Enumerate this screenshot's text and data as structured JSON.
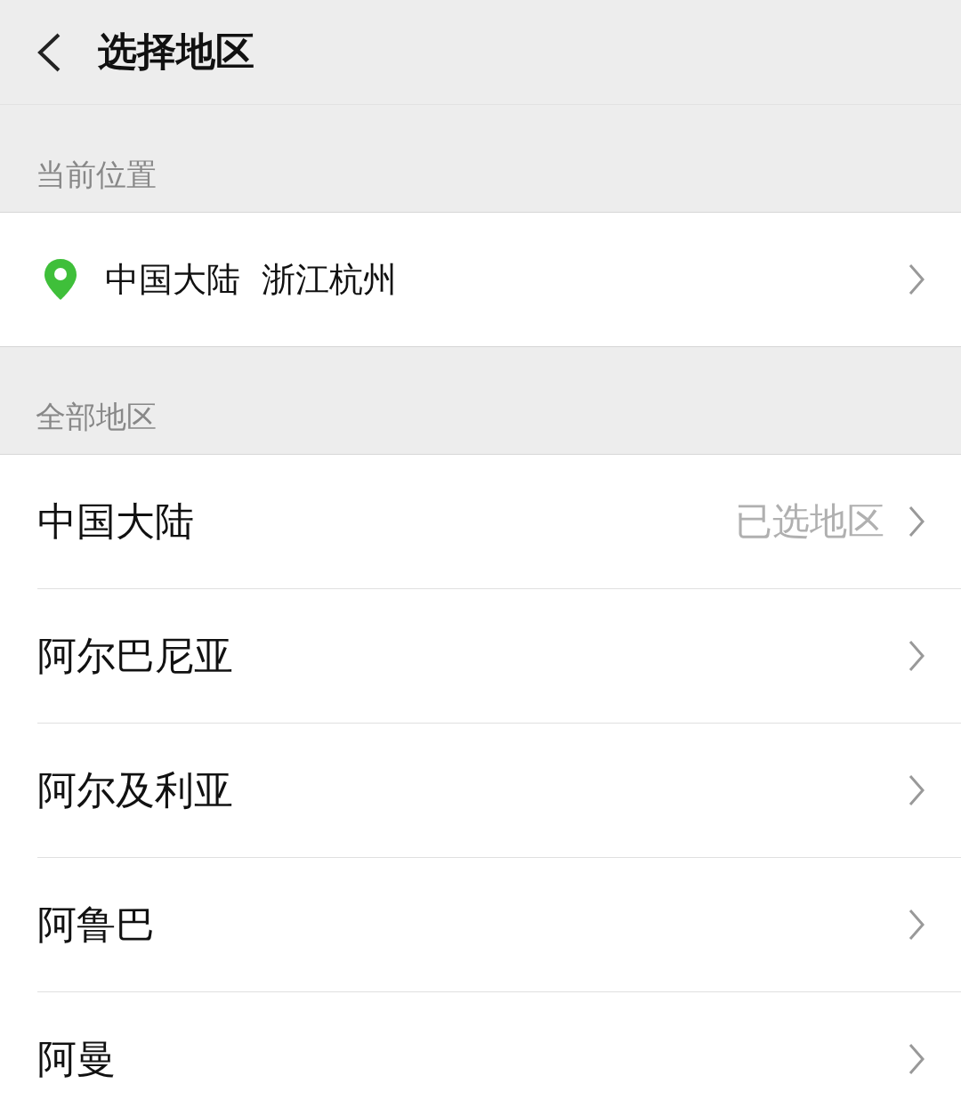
{
  "header": {
    "title": "选择地区"
  },
  "current_location": {
    "section_label": "当前位置",
    "location": "中国大陆  浙江杭州"
  },
  "all_regions": {
    "section_label": "全部地区",
    "rows": [
      {
        "name": "中国大陆",
        "note": "已选地区"
      },
      {
        "name": "阿尔巴尼亚"
      },
      {
        "name": "阿尔及利亚"
      },
      {
        "name": "阿鲁巴"
      },
      {
        "name": "阿曼"
      }
    ]
  }
}
